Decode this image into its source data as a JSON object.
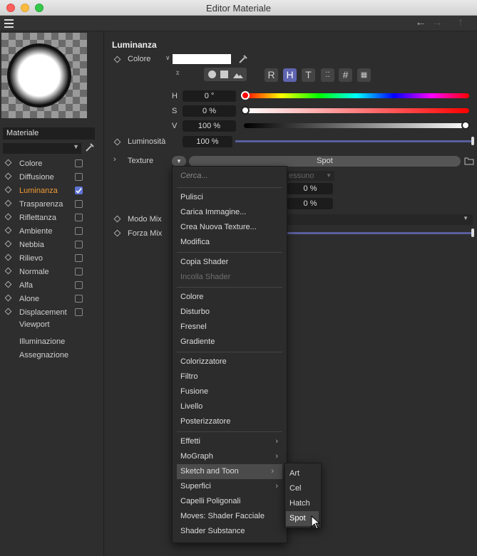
{
  "window": {
    "title": "Editor Materiale"
  },
  "sidebar": {
    "material_label": "Materiale",
    "channels": [
      {
        "label": "Colore",
        "checked": false,
        "active": false
      },
      {
        "label": "Diffusione",
        "checked": false,
        "active": false
      },
      {
        "label": "Luminanza",
        "checked": true,
        "active": true
      },
      {
        "label": "Trasparenza",
        "checked": false,
        "active": false
      },
      {
        "label": "Riflettanza",
        "checked": false,
        "active": false
      },
      {
        "label": "Ambiente",
        "checked": false,
        "active": false
      },
      {
        "label": "Nebbia",
        "checked": false,
        "active": false
      },
      {
        "label": "Rilievo",
        "checked": false,
        "active": false
      },
      {
        "label": "Normale",
        "checked": false,
        "active": false
      },
      {
        "label": "Alfa",
        "checked": false,
        "active": false
      },
      {
        "label": "Alone",
        "checked": false,
        "active": false
      },
      {
        "label": "Displacement",
        "checked": false,
        "active": false
      }
    ],
    "viewport": "Viewport",
    "illuminazione": "Illuminazione",
    "assegnazione": "Assegnazione"
  },
  "panel": {
    "section_title": "Luminanza",
    "colore_label": "Colore",
    "mode_buttons": [
      "R",
      "H",
      "T"
    ],
    "h_label": "H",
    "h_value": "0 °",
    "s_label": "S",
    "s_value": "0 %",
    "v_label": "V",
    "v_value": "100 %",
    "v_level": 1.0,
    "luminosita_label": "Luminosità",
    "luminosita_value": "100 %",
    "luminosita_level": 1.0,
    "texture_label": "Texture",
    "texture_value": "Spot",
    "behind_text": "essuno",
    "pct1": "0 %",
    "pct2": "0 %",
    "modo_mix_label": "Modo Mix",
    "forza_mix_label": "Forza Mix"
  },
  "menu": {
    "search_placeholder": "Cerca...",
    "groups": [
      [
        {
          "label": "Pulisci"
        },
        {
          "label": "Carica Immagine..."
        },
        {
          "label": "Crea Nuova Texture..."
        },
        {
          "label": "Modifica"
        }
      ],
      [
        {
          "label": "Copia Shader"
        },
        {
          "label": "Incolla Shader",
          "disabled": true
        }
      ],
      [
        {
          "label": "Colore"
        },
        {
          "label": "Disturbo"
        },
        {
          "label": "Fresnel"
        },
        {
          "label": "Gradiente"
        }
      ],
      [
        {
          "label": "Colorizzatore"
        },
        {
          "label": "Filtro"
        },
        {
          "label": "Fusione"
        },
        {
          "label": "Livello"
        },
        {
          "label": "Posterizzatore"
        }
      ],
      [
        {
          "label": "Effetti",
          "submenu": true
        },
        {
          "label": "MoGraph",
          "submenu": true
        },
        {
          "label": "Sketch and Toon",
          "submenu": true,
          "highlighted": true
        },
        {
          "label": "Superfici",
          "submenu": true
        },
        {
          "label": "Capelli Poligonali"
        },
        {
          "label": "Moves: Shader Facciale"
        },
        {
          "label": "Shader Substance"
        }
      ]
    ]
  },
  "submenu": {
    "items": [
      "Art",
      "Cel",
      "Hatch",
      "Spot"
    ],
    "selected": "Spot"
  },
  "colors": {
    "accent": "#f09a34",
    "hbutton": "#5f65b0",
    "slider_track": "#5a5f9e"
  }
}
